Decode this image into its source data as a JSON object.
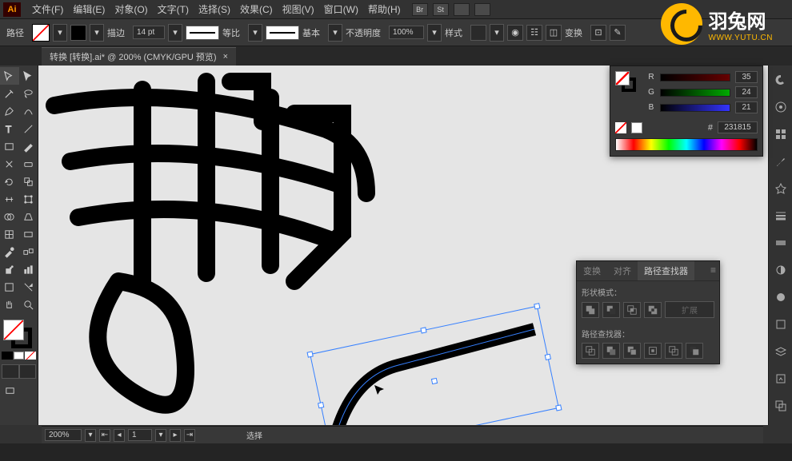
{
  "app": {
    "logo": "Ai"
  },
  "menu": {
    "items": [
      "文件(F)",
      "编辑(E)",
      "对象(O)",
      "文字(T)",
      "选择(S)",
      "效果(C)",
      "视图(V)",
      "窗口(W)",
      "帮助(H)"
    ],
    "icon_labels": [
      "Br",
      "St"
    ]
  },
  "controlbar": {
    "selection_label": "路径",
    "stroke_label": "描边",
    "stroke_value": "14 pt",
    "profile_label": "等比",
    "brush_label": "基本",
    "opacity_label": "不透明度",
    "opacity_value": "100%",
    "style_label": "样式",
    "transform_label": "变换"
  },
  "doctab": {
    "title": "转换  [转换].ai* @ 200% (CMYK/GPU 预览)",
    "close": "×"
  },
  "color_panel": {
    "r_label": "R",
    "r_value": "35",
    "g_label": "G",
    "g_value": "24",
    "b_label": "B",
    "b_value": "21",
    "hex_label": "#",
    "hex_value": "231815"
  },
  "pathfinder": {
    "tabs": [
      "变换",
      "对齐",
      "路径查找器"
    ],
    "section1_label": "形状模式：",
    "expand_label": "扩展",
    "section2_label": "路径查找器："
  },
  "statusbar": {
    "zoom": "200%",
    "artboard_nav": "1",
    "tool_label": "选择"
  },
  "watermark": {
    "main": "羽兔网",
    "sub": "WWW.YUTU.CN"
  }
}
